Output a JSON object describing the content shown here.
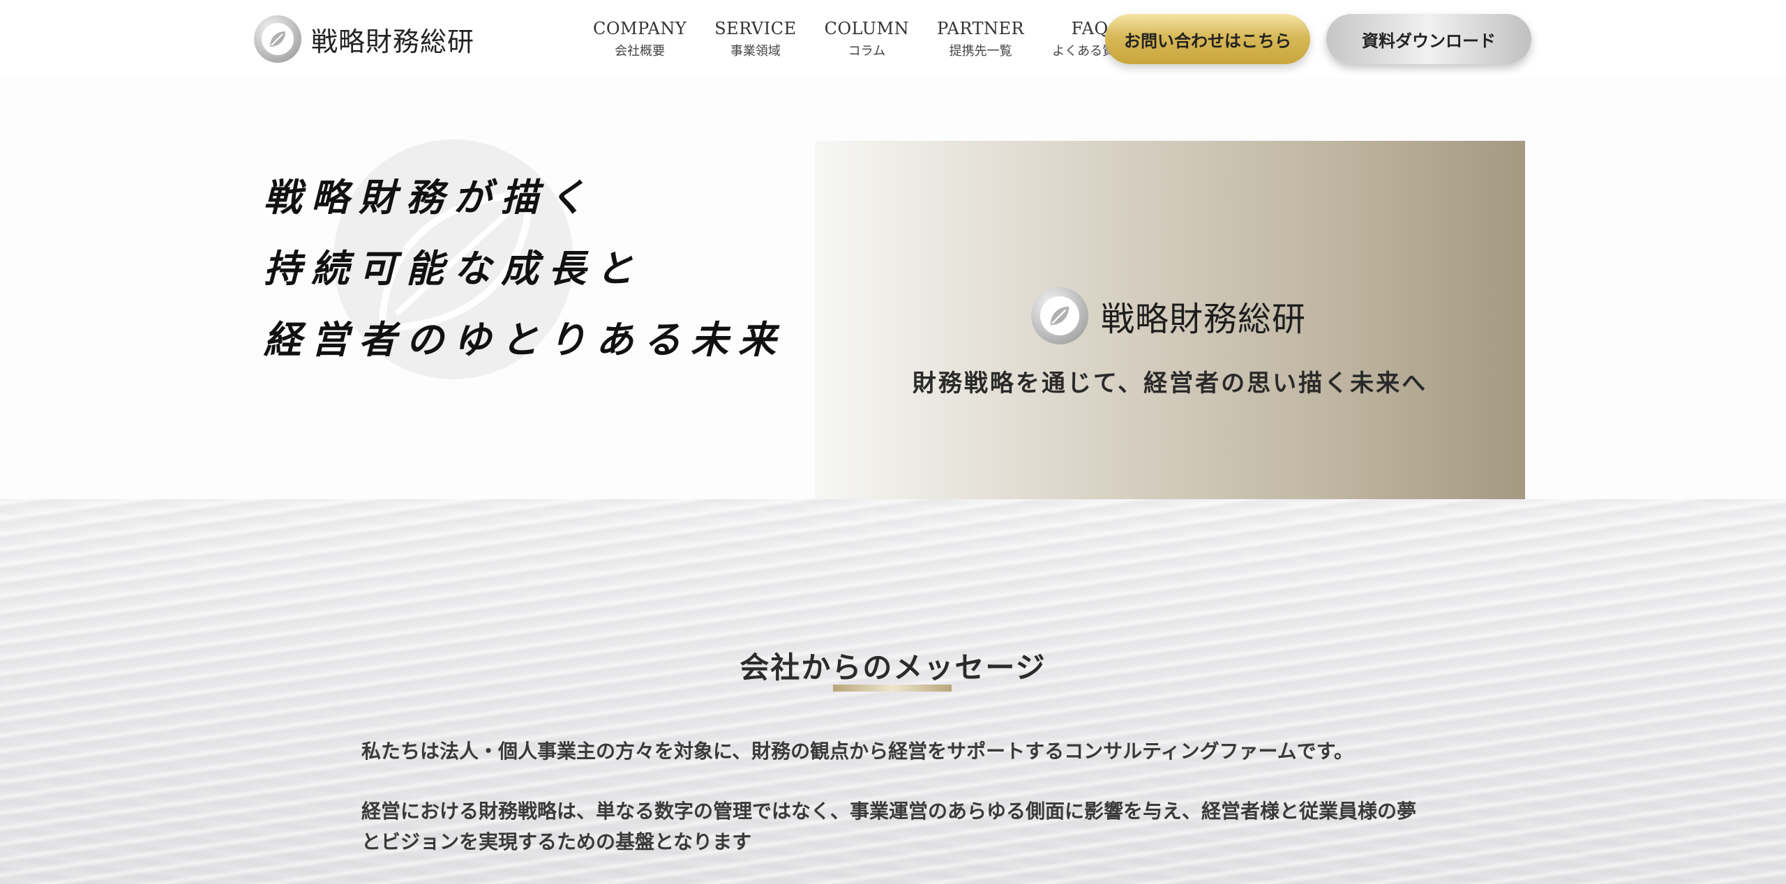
{
  "header": {
    "brand": "戦略財務総研",
    "nav": [
      {
        "en": "COMPANY",
        "ja": "会社概要"
      },
      {
        "en": "SERVICE",
        "ja": "事業領域"
      },
      {
        "en": "COLUMN",
        "ja": "コラム"
      },
      {
        "en": "PARTNER",
        "ja": "提携先一覧"
      },
      {
        "en": "FAQ",
        "ja": "よくある質問"
      }
    ],
    "contact_button": "お問い合わせはこちら",
    "download_button": "資料ダウンロード"
  },
  "hero": {
    "lines": [
      "戦略財務が描く",
      "持続可能な成長と",
      "経営者のゆとりある未来"
    ],
    "card_brand": "戦略財務総研",
    "card_tagline": "財務戦略を通じて、経営者の思い描く未来へ"
  },
  "message": {
    "title": "会社からのメッセージ",
    "paragraphs": [
      "私たちは法人・個人事業主の方々を対象に、財務の観点から経営をサポートするコンサルティングファームです。",
      "経営における財務戦略は、単なる数字の管理ではなく、事業運営のあらゆる側面に影響を与え、経営者様と従業員様の夢とビジョンを実現するための基盤となります"
    ]
  },
  "colors": {
    "gold_accent": "#d8b958",
    "silver_accent": "#d9d9d9"
  }
}
